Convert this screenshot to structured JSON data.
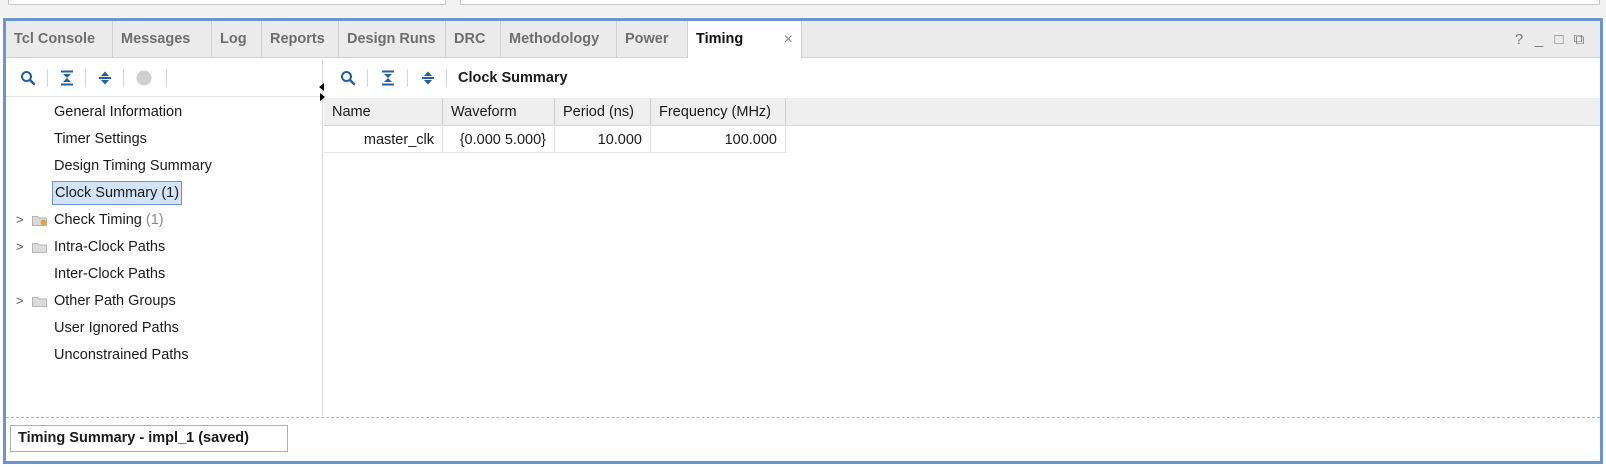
{
  "tabs": [
    {
      "label": "Tcl Console",
      "active": false
    },
    {
      "label": "Messages",
      "active": false
    },
    {
      "label": "Log",
      "active": false
    },
    {
      "label": "Reports",
      "active": false
    },
    {
      "label": "Design Runs",
      "active": false
    },
    {
      "label": "DRC",
      "active": false
    },
    {
      "label": "Methodology",
      "active": false
    },
    {
      "label": "Power",
      "active": false
    },
    {
      "label": "Timing",
      "active": true
    }
  ],
  "tab_close_glyph": "×",
  "window_controls": {
    "help": "?",
    "minimize": "_",
    "maximize": "□",
    "float": "⧉"
  },
  "left_toolbar_icons": [
    "search-icon",
    "collapse-all-icon",
    "expand-all-icon",
    "stop-icon"
  ],
  "tree": [
    {
      "label": "General Information",
      "count": "",
      "expandable": false,
      "folder": "",
      "selected": false
    },
    {
      "label": "Timer Settings",
      "count": "",
      "expandable": false,
      "folder": "",
      "selected": false
    },
    {
      "label": "Design Timing Summary",
      "count": "",
      "expandable": false,
      "folder": "",
      "selected": false
    },
    {
      "label": "Clock Summary (1)",
      "count": "",
      "expandable": false,
      "folder": "",
      "selected": true
    },
    {
      "label": "Check Timing",
      "count": "(1)",
      "expandable": true,
      "folder": "warning",
      "selected": false
    },
    {
      "label": "Intra-Clock Paths",
      "count": "",
      "expandable": true,
      "folder": "plain",
      "selected": false
    },
    {
      "label": "Inter-Clock Paths",
      "count": "",
      "expandable": false,
      "folder": "",
      "selected": false
    },
    {
      "label": "Other Path Groups",
      "count": "",
      "expandable": true,
      "folder": "plain",
      "selected": false
    },
    {
      "label": "User Ignored Paths",
      "count": "",
      "expandable": false,
      "folder": "",
      "selected": false
    },
    {
      "label": "Unconstrained Paths",
      "count": "",
      "expandable": false,
      "folder": "",
      "selected": false
    }
  ],
  "expander_glyph": ">",
  "right_panel": {
    "title": "Clock Summary",
    "columns": [
      "Name",
      "Waveform",
      "Period (ns)",
      "Frequency (MHz)"
    ],
    "rows": [
      [
        "master_clk",
        "{0.000 5.000}",
        "10.000",
        "100.000"
      ]
    ]
  },
  "status_tab": "Timing Summary - impl_1 (saved)",
  "colors": {
    "accent": "#6b94d1",
    "icon_blue": "#1f5fa8",
    "selection_bg": "#d4e4f8",
    "warning_folder": "#e8a23a"
  }
}
